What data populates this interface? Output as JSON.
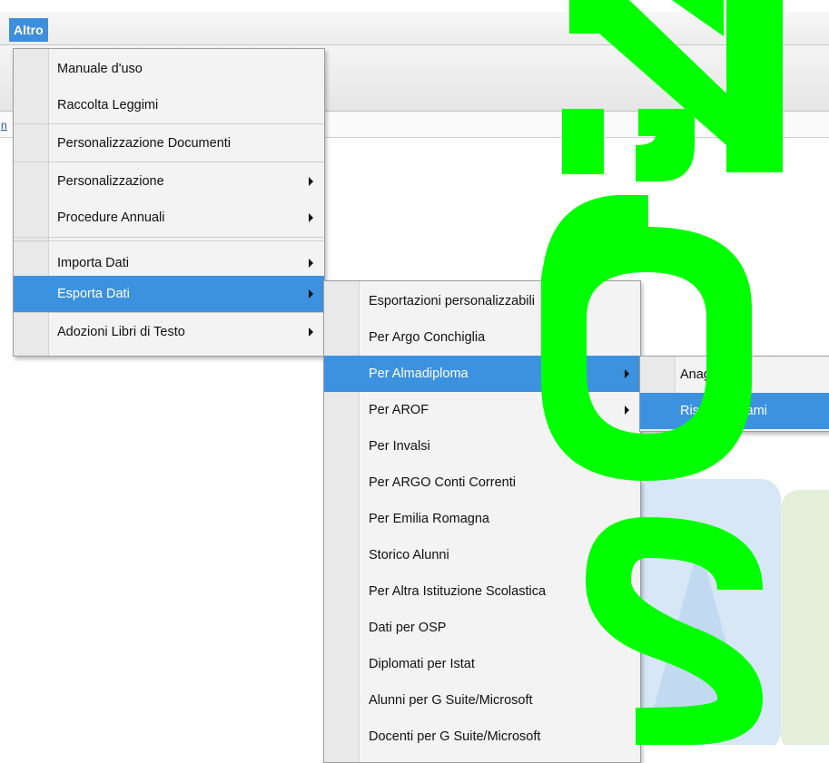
{
  "menubar": {
    "altro_label": "Altro"
  },
  "background": {
    "link_stub": "n"
  },
  "menu_altro": {
    "items": [
      {
        "label": "Manuale d'uso"
      },
      {
        "label": "Raccolta Leggimi"
      },
      {
        "label": "Personalizzazione Documenti"
      },
      {
        "label": "Personalizzazione"
      },
      {
        "label": "Procedure Annuali"
      },
      {
        "label": "Importa Dati"
      },
      {
        "label": "Esporta Dati"
      },
      {
        "label": "Adozioni Libri di Testo"
      }
    ]
  },
  "menu_esporta": {
    "items": [
      {
        "label": "Esportazioni personalizzabili"
      },
      {
        "label": "Per Argo Conchiglia"
      },
      {
        "label": "Per Almadiploma"
      },
      {
        "label": "Per AROF"
      },
      {
        "label": "Per Invalsi"
      },
      {
        "label": "Per ARGO Conti Correnti"
      },
      {
        "label": "Per Emilia Romagna"
      },
      {
        "label": "Storico Alunni"
      },
      {
        "label": "Per Altra Istituzione Scolastica"
      },
      {
        "label": "Dati per OSP"
      },
      {
        "label": "Diplomati per Istat"
      },
      {
        "label": "Alunni per G Suite/Microsoft"
      },
      {
        "label": "Docenti per G Suite/Microsoft"
      }
    ]
  },
  "menu_almadiploma": {
    "items": [
      {
        "label": "Anagrafe"
      },
      {
        "label": "Risultati Esami"
      }
    ]
  },
  "colors": {
    "highlight": "#3d92e0",
    "watermark": "#00ff00",
    "menu_bg": "#f3f3f3"
  }
}
